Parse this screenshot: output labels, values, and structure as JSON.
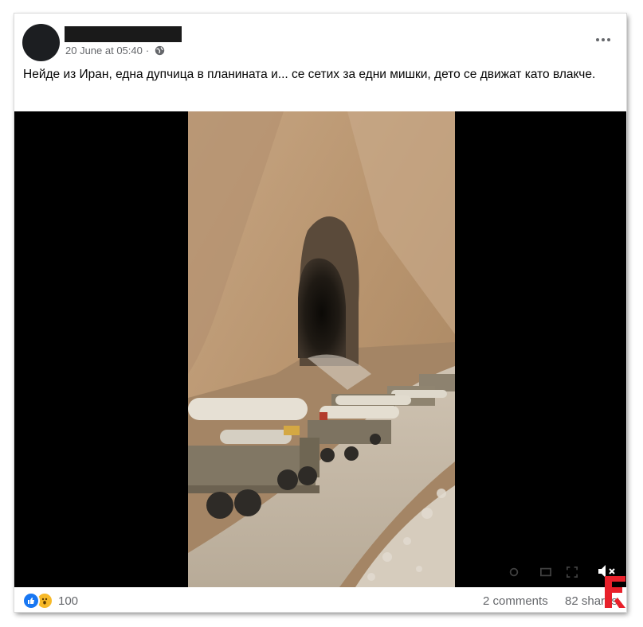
{
  "post": {
    "timestamp": "20 June at 05:40",
    "privacy_icon": "globe-icon",
    "text": "Нейде из Иран, една дупчица в планината и... се сетих за едни мишки, дето се движат като влакче."
  },
  "media": {
    "type": "video",
    "mute_icon": "speaker-muted-icon"
  },
  "footer": {
    "reaction_icons": [
      "like-icon",
      "wow-icon"
    ],
    "reaction_count": "100",
    "comments": "2 comments",
    "shares": "82 shares"
  },
  "colors": {
    "like_blue": "#1877f2",
    "wow_yellow": "#f7b928",
    "meta_gray": "#65676b",
    "watermark_red": "#e8202a"
  }
}
